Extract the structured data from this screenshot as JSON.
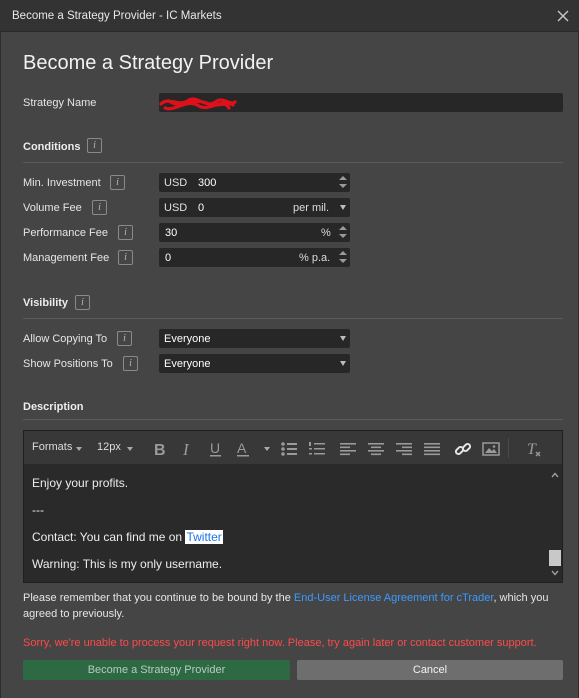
{
  "window": {
    "title": "Become a Strategy Provider - IC Markets"
  },
  "dialog": {
    "heading": "Become a Strategy Provider",
    "strategy_name_label": "Strategy Name",
    "info_glyph": "i",
    "conditions": {
      "title": "Conditions",
      "min_investment": {
        "label": "Min. Investment",
        "currency": "USD",
        "value": "300"
      },
      "volume_fee": {
        "label": "Volume Fee",
        "currency": "USD",
        "value": "0",
        "unit": "per mil."
      },
      "performance_fee": {
        "label": "Performance Fee",
        "value": "30",
        "unit": "%"
      },
      "management_fee": {
        "label": "Management Fee",
        "value": "0",
        "unit": "% p.a."
      }
    },
    "visibility": {
      "title": "Visibility",
      "allow_copying": {
        "label": "Allow Copying To",
        "value": "Everyone"
      },
      "show_positions": {
        "label": "Show Positions To",
        "value": "Everyone"
      }
    },
    "description": {
      "title": "Description",
      "toolbar": {
        "formats": "Formats",
        "font_size": "12px"
      },
      "lines": {
        "l1": "Enjoy your profits.",
        "l2": "---",
        "l3_prefix": "Contact: You can find me on ",
        "l3_link": "Twitter",
        "l4": "Warning: This is my only username."
      }
    },
    "notice": {
      "before": "Please remember that you continue to be bound by the ",
      "link": "End-User License Agreement for cTrader",
      "after": ", which you agreed to previously."
    },
    "error": "Sorry, we're unable to process your request right now. Please, try again later or contact customer support.",
    "buttons": {
      "submit": "Become a Strategy Provider",
      "cancel": "Cancel"
    }
  },
  "colors": {
    "error": "#ff4a4a",
    "link": "#3b9bff",
    "primary_button": "#2d6a44",
    "redaction": "#e0101a"
  }
}
